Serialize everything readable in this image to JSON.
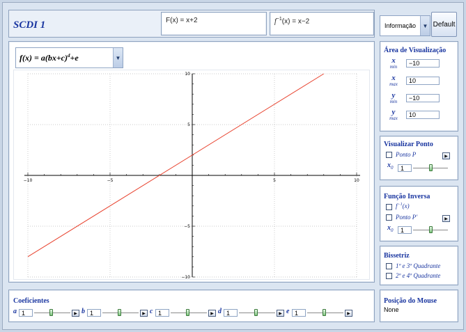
{
  "header": {
    "title": "SCDI 1",
    "function_text": "F(x) = x+2",
    "inverse_function": {
      "f": "f",
      "exp": "−1",
      "rest": "(x) = x−2"
    },
    "info_select": "Informação",
    "default_button": "Default"
  },
  "function_select": {
    "lhs": "f(x)",
    "rhs_before_exp": " = a(bx+c)",
    "exp": "d",
    "rhs_after_exp": "+e"
  },
  "plot": {
    "x_ticks": [
      "−10",
      "−5",
      "5",
      "10"
    ],
    "y_ticks": [
      "10",
      "5",
      "−5",
      "−10"
    ],
    "line_color": "#e8422e"
  },
  "chart_data": {
    "type": "line",
    "series": [
      {
        "x": [
          -10,
          8
        ],
        "y": [
          -8,
          10
        ]
      }
    ],
    "xlim": [
      -10,
      10
    ],
    "ylim": [
      -10,
      10
    ],
    "grid": true
  },
  "area_visualizacao": {
    "title": "Área de Visualização",
    "fields": [
      {
        "var": "x",
        "sub": "min",
        "value": "−10"
      },
      {
        "var": "x",
        "sub": "max",
        "value": "10"
      },
      {
        "var": "y",
        "sub": "min",
        "value": "−10"
      },
      {
        "var": "y",
        "sub": "max",
        "value": "10"
      }
    ]
  },
  "visualizar_ponto": {
    "title": "Visualizar Ponto",
    "checkbox_label": "Ponto P",
    "x_label": "x",
    "x_sub": "0",
    "x_value": "1"
  },
  "funcao_inversa": {
    "title": "Função Inversa",
    "checkbox1_f": "f",
    "checkbox1_exp": "−1",
    "checkbox1_rest": "(x)",
    "checkbox2_label": "Ponto P'",
    "x_label": "x",
    "x_sub": "0",
    "x_value": "1"
  },
  "bissetriz": {
    "title": "Bissetriz",
    "option1": "1º e 3º Quadrante",
    "option2": "2º e 4º Quadrante"
  },
  "coeficientes": {
    "title": "Coeficientes",
    "items": [
      {
        "name": "a",
        "value": "1"
      },
      {
        "name": "b",
        "value": "1"
      },
      {
        "name": "c",
        "value": "1"
      },
      {
        "name": "d",
        "value": "1"
      },
      {
        "name": "e",
        "value": "1"
      }
    ]
  },
  "posicao_mouse": {
    "title": "Posição do Mouse",
    "value": "None"
  }
}
